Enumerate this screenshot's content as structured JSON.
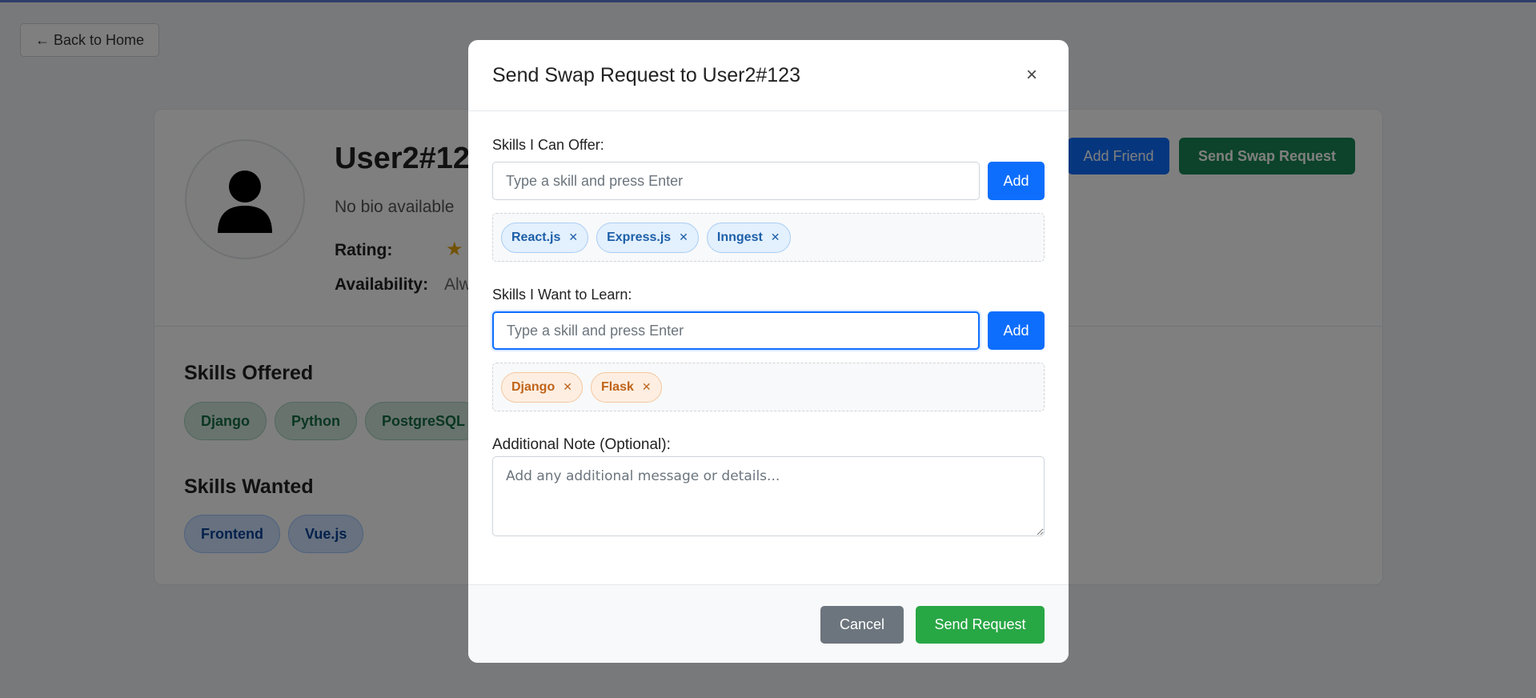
{
  "background_page": {
    "back_button": "← Back to Home",
    "user_name": "User2#123",
    "bio": "No bio available",
    "rating_label": "Rating:",
    "rating_icon": "star-icon",
    "availability_label": "Availability:",
    "availability_value": "Alw",
    "add_friend_label": "Add Friend",
    "send_swap_label": "Send Swap Request",
    "skills_offered_title": "Skills Offered",
    "skills_offered": [
      "Django",
      "Python",
      "PostgreSQL"
    ],
    "skills_wanted_title": "Skills Wanted",
    "skills_wanted": [
      "Frontend",
      "Vue.js"
    ]
  },
  "modal": {
    "title": "Send Swap Request to User2#123",
    "close_label": "×",
    "offer": {
      "label": "Skills I Can Offer:",
      "placeholder": "Type a skill and press Enter",
      "add_label": "Add",
      "tags": [
        "React.js",
        "Express.js",
        "Inngest"
      ]
    },
    "learn": {
      "label": "Skills I Want to Learn:",
      "placeholder": "Type a skill and press Enter",
      "add_label": "Add",
      "tags": [
        "Django",
        "Flask"
      ]
    },
    "note": {
      "label": "Additional Note (Optional):",
      "placeholder": "Add any additional message or details..."
    },
    "cancel_label": "Cancel",
    "send_label": "Send Request"
  },
  "colors": {
    "primary": "#0d6efd",
    "success": "#28a745",
    "secondary": "#6c757d"
  }
}
